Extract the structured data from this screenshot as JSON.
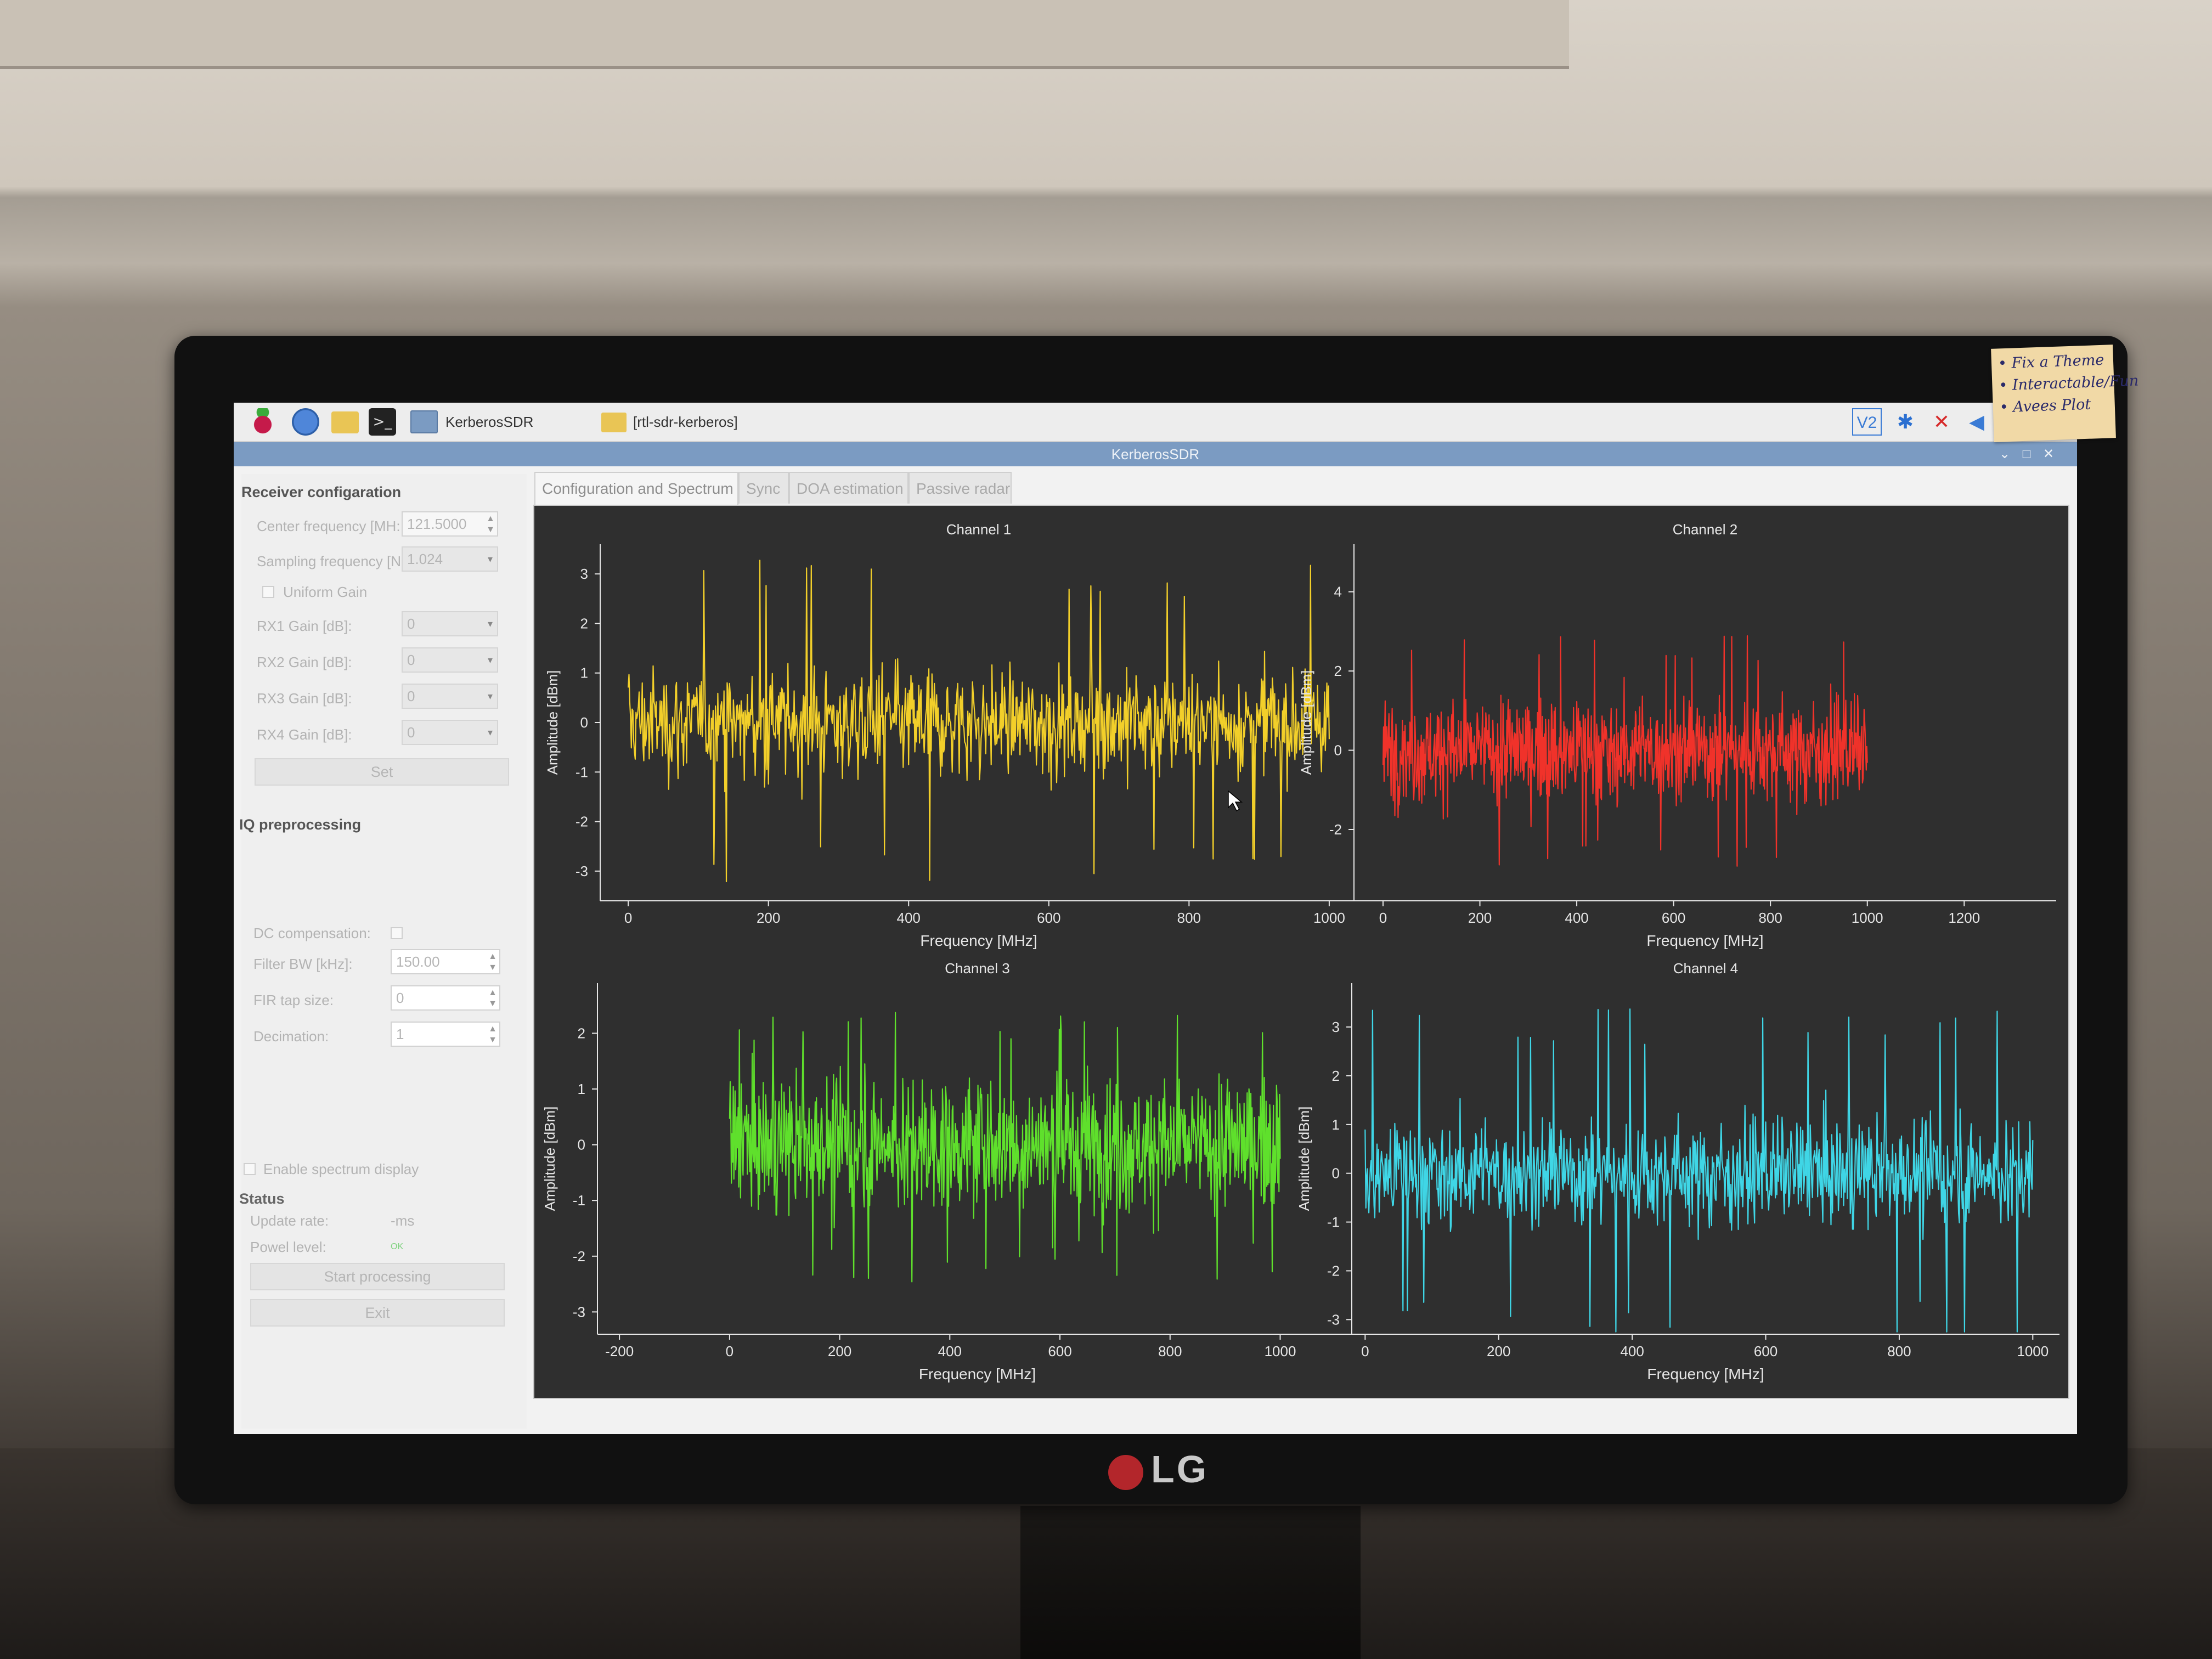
{
  "taskbar": {
    "tasks": [
      "KerberosSDR",
      "[rtl-sdr-kerberos]"
    ],
    "tray": {
      "vnc": "V2",
      "bluetooth": "bluetooth-icon",
      "network": "network-disconnected-icon",
      "volume": "volume-icon"
    }
  },
  "window": {
    "title": "KerberosSDR"
  },
  "sticky_note": {
    "lines": [
      "• Fix a Theme",
      "• Interactable/Fun",
      "• Avees Plot"
    ]
  },
  "monitor": {
    "brand": "LG"
  },
  "panel": {
    "receiver_title": "Receiver configaration",
    "center_freq_label": "Center frequency [MH:",
    "center_freq_value": "121.5000",
    "sampling_freq_label": "Sampling frequency [N",
    "sampling_freq_value": "1.024",
    "uniform_gain_label": "Uniform Gain",
    "rx1_label": "RX1 Gain [dB]:",
    "rx1_value": "0",
    "rx2_label": "RX2 Gain [dB]:",
    "rx2_value": "0",
    "rx3_label": "RX3 Gain [dB]:",
    "rx3_value": "0",
    "rx4_label": "RX4 Gain [dB]:",
    "rx4_value": "0",
    "set_button": "Set",
    "iq_title": "IQ preprocessing",
    "dc_label": "DC compensation:",
    "filter_bw_label": "Filter BW [kHz]:",
    "filter_bw_value": "150.00",
    "fir_label": "FIR tap size:",
    "fir_value": "0",
    "decimation_label": "Decimation:",
    "decimation_value": "1",
    "enable_spectrum_label": "Enable spectrum display",
    "status_title": "Status",
    "update_rate_label": "Update rate:",
    "update_rate_value": "-ms",
    "power_level_label": "Powel level:",
    "power_level_value": "OK",
    "start_button": "Start processing",
    "exit_button": "Exit"
  },
  "tabs": [
    "Configuration and Spectrum",
    "Sync",
    "DOA estimation",
    "Passive radar"
  ],
  "colors": {
    "ch1": "#f2cf2a",
    "ch2": "#f0322a",
    "ch3": "#5fe02c",
    "ch4": "#3fd6e6",
    "plot_bg": "#2f2f2f",
    "axis": "#e6e6e6"
  },
  "chart_data": [
    {
      "type": "line",
      "title": "Channel 1",
      "xlabel": "Frequency [MHz]",
      "ylabel": "Amplitude [dBm]",
      "xticks": [
        "0",
        "200",
        "400",
        "600",
        "800",
        "1000"
      ],
      "yticks": [
        "3",
        "2",
        "1",
        "0",
        "-1",
        "-2",
        "-3"
      ],
      "xlim": [
        -40,
        1040
      ],
      "ylim": [
        -3.6,
        3.6
      ],
      "data_x_range": [
        0,
        1000
      ],
      "amplitude_typical": 1.0,
      "amplitude_peak": 3.3
    },
    {
      "type": "line",
      "title": "Channel 2",
      "xlabel": "Frequency [MHz]",
      "ylabel": "Amplitude [dBm]",
      "xticks": [
        "0",
        "200",
        "400",
        "600",
        "800",
        "1000",
        "1200"
      ],
      "yticks": [
        "4",
        "2",
        "0",
        "-2"
      ],
      "xlim": [
        -60,
        1390
      ],
      "ylim": [
        -3.8,
        5.2
      ],
      "data_x_range": [
        0,
        1000
      ],
      "amplitude_typical": 1.2,
      "amplitude_peak": 3.0
    },
    {
      "type": "line",
      "title": "Channel 3",
      "xlabel": "Frequency [MHz]",
      "ylabel": "Amplitude [dBm]",
      "xticks": [
        "-200",
        "0",
        "200",
        "400",
        "600",
        "800",
        "1000"
      ],
      "yticks": [
        "2",
        "1",
        "0",
        "-1",
        "-2",
        "-3"
      ],
      "xlim": [
        -240,
        1140
      ],
      "ylim": [
        -3.4,
        2.9
      ],
      "data_x_range": [
        0,
        1000
      ],
      "amplitude_typical": 1.1,
      "amplitude_peak": 2.5
    },
    {
      "type": "line",
      "title": "Channel 4",
      "xlabel": "Frequency [MHz]",
      "ylabel": "Amplitude [dBm]",
      "xticks": [
        "0",
        "200",
        "400",
        "600",
        "800",
        "1000"
      ],
      "yticks": [
        "3",
        "2",
        "1",
        "0",
        "-1",
        "-2",
        "-3"
      ],
      "xlim": [
        -20,
        1040
      ],
      "ylim": [
        -3.3,
        3.9
      ],
      "data_x_range": [
        0,
        1000
      ],
      "amplitude_typical": 1.0,
      "amplitude_peak": 3.5
    }
  ]
}
